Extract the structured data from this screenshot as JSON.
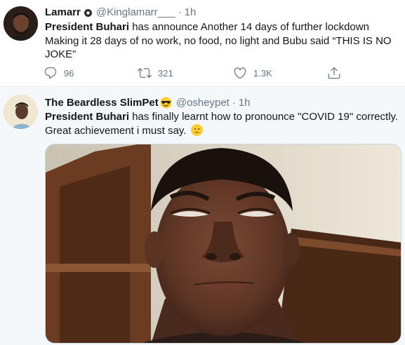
{
  "tweets": [
    {
      "name": "Lamarr",
      "handle": "@Kinglamarr___",
      "separator": "·",
      "time": "1h",
      "text_bold": "President Buhari",
      "text_rest": " has announce Another 14 days of further lockdown Making it 28 days of no work, no food, no light and Bubu said “THIS IS NO JOKE”",
      "replies": "96",
      "retweets": "321",
      "likes": "1.3K"
    },
    {
      "name": "The Beardless SlimPet",
      "name_emoji": "smiling-face-with-sunglasses",
      "handle": "@osheypet",
      "separator": "·",
      "time": "1h",
      "text_bold": "President Buhari",
      "text_rest": " has finally learnt how to pronounce \"COVID 19\" correctly. Great achievement i must say.",
      "text_emoji": "slightly-frowning-face",
      "photo": "selfie-young-man-squinting"
    }
  ],
  "colors": {
    "text": "#14171a",
    "muted": "#657786",
    "border": "#e6ecf0",
    "hover_bg": "#f5f8fa"
  },
  "icons": [
    "reply-icon",
    "retweet-icon",
    "like-icon",
    "share-icon",
    "verified-badge-icon"
  ]
}
